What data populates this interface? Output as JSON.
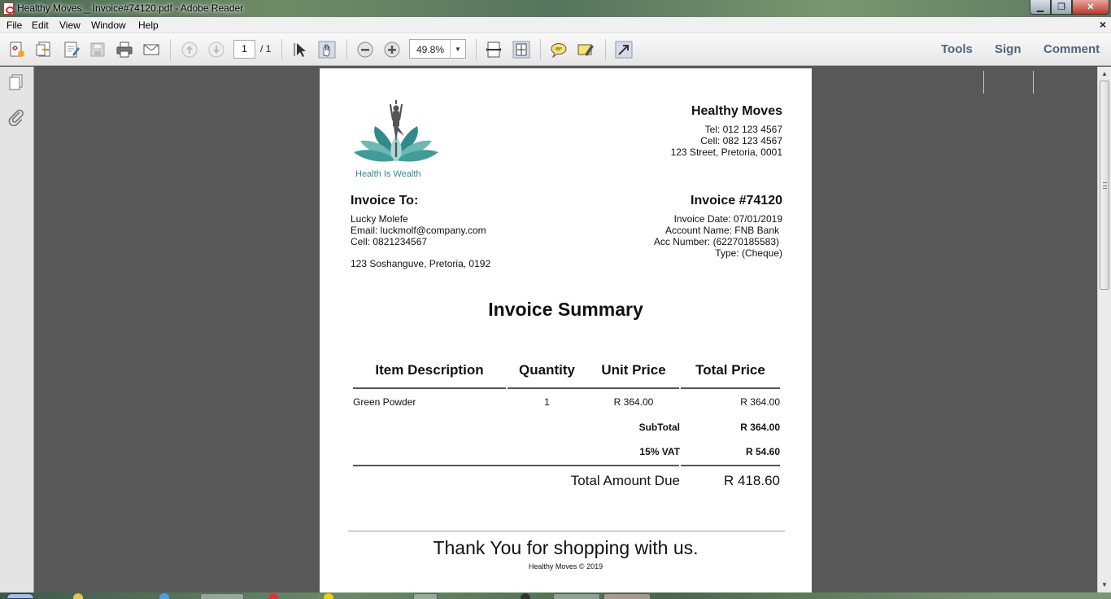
{
  "window": {
    "title": "Healthy Moves _ Invoice#74120.pdf - Adobe Reader",
    "min_glyph": "▁",
    "max_glyph": "❐",
    "close_glyph": "✕"
  },
  "menu": {
    "items": [
      "File",
      "Edit",
      "View",
      "Window",
      "Help"
    ],
    "close_glyph": "×"
  },
  "toolbar": {
    "page_current": "1",
    "page_total": "/ 1",
    "zoom": "49.8%",
    "zoom_arrow": "▼",
    "right_links": [
      "Tools",
      "Sign",
      "Comment"
    ]
  },
  "scrollbar": {
    "up": "▲",
    "down": "▼"
  },
  "document": {
    "logo_text": "Health Is Wealth",
    "company": {
      "name": "Healthy Moves",
      "tel": "Tel: 012 123 4567",
      "cell": "Cell: 082 123 4567",
      "address": "123 Street, Pretoria, 0001"
    },
    "bill_to": {
      "heading": "Invoice To:",
      "name": "Lucky Molefe",
      "email": "Email: luckmolf@company.com",
      "cell": "Cell: 0821234567",
      "address": "123 Soshanguve, Pretoria, 0192"
    },
    "invoice": {
      "number": "Invoice #74120",
      "date": "Invoice Date: 07/01/2019",
      "account_name": "Account Name: FNB Bank",
      "acc_number": "Acc Number: (62270185583)",
      "type": "Type: (Cheque)"
    },
    "summary_title": "Invoice Summary",
    "table": {
      "headers": [
        "Item Description",
        "Quantity",
        "Unit Price",
        "Total Price"
      ],
      "rows": [
        {
          "description": "Green Powder",
          "quantity": "1",
          "unit_price": "R 364.00",
          "total": "R 364.00"
        }
      ],
      "subtotal_label": "SubTotal",
      "subtotal_value": "R 364.00",
      "vat_label": "15% VAT",
      "vat_value": "R 54.60",
      "total_label": "Total Amount Due",
      "total_value": "R 418.60"
    },
    "thanks": "Thank You for shopping with us.",
    "footer": "Healthy Moves © 2019"
  }
}
